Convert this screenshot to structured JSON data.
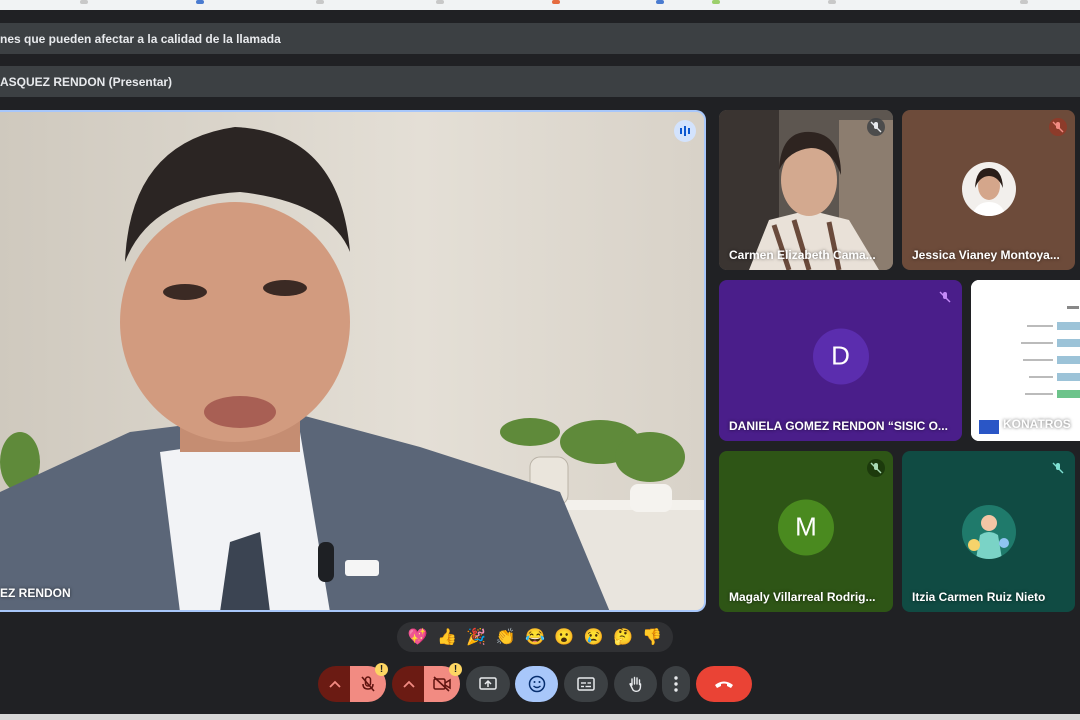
{
  "banner": {
    "network_warning": "nes que pueden afectar a la calidad de la llamada"
  },
  "presenter_bar": {
    "text": "ASQUEZ RENDON (Presentar)"
  },
  "main_tile": {
    "name": "EZ RENDON"
  },
  "participants": [
    {
      "name": "Carmen Elizabeth Cama...",
      "muted": true
    },
    {
      "name": "Jessica Vianey Montoya...",
      "muted": true
    },
    {
      "name": "DANIELA GOMEZ RENDON “SISIC O...",
      "initial": "D",
      "muted": true
    },
    {
      "name": "KONATROS"
    },
    {
      "name": "Magaly Villarreal Rodrig...",
      "initial": "M",
      "muted": true
    },
    {
      "name": "Itzia Carmen Ruiz Nieto",
      "muted": true
    }
  ],
  "reactions": [
    "💖",
    "👍",
    "🎉",
    "👏",
    "😂",
    "😮",
    "😢",
    "🤔",
    "👎"
  ],
  "controls": {
    "mic_badge": "!",
    "camera_badge": "!"
  },
  "colors": {
    "accent": "#a8c7fa",
    "end_call": "#ea4335",
    "danger": "#f28b82"
  }
}
